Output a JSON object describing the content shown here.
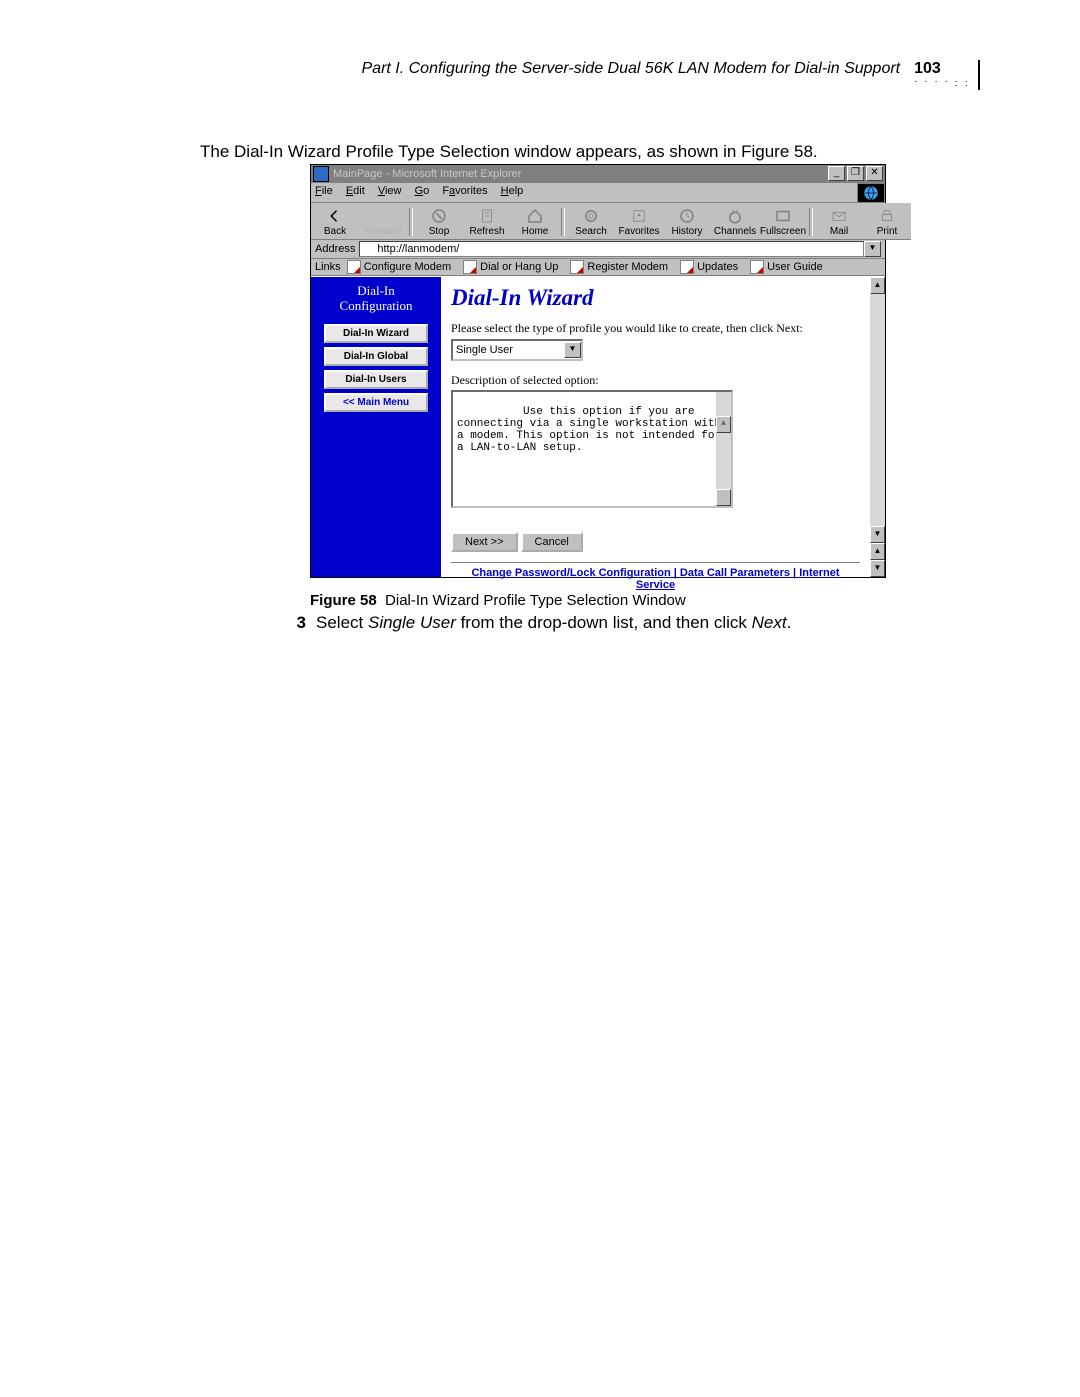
{
  "header": {
    "title": "Part I. Configuring the Server-side Dual 56K LAN Modem for Dial-in Support",
    "page_number": "103"
  },
  "intro_text": "The Dial-In Wizard Profile Type Selection window appears, as shown in Figure 58.",
  "figure": {
    "label": "Figure 58",
    "caption": "Dial-In Wizard Profile Type Selection Window"
  },
  "step": {
    "number": "3",
    "text_pre": "Select ",
    "italic1": "Single User",
    "text_mid": " from the drop-down list, and then click ",
    "italic2": "Next",
    "text_post": "."
  },
  "ie": {
    "title": "MainPage - Microsoft Internet Explorer",
    "menus": {
      "file": "File",
      "edit": "Edit",
      "view": "View",
      "go": "Go",
      "favorites": "Favorites",
      "help": "Help"
    },
    "toolbar": {
      "back": "Back",
      "forward": "Forward",
      "stop": "Stop",
      "refresh": "Refresh",
      "home": "Home",
      "search": "Search",
      "favorites": "Favorites",
      "history": "History",
      "channels": "Channels",
      "fullscreen": "Fullscreen",
      "mail": "Mail",
      "print": "Print"
    },
    "address_label": "Address",
    "address_value": "http://lanmodem/",
    "links_label": "Links",
    "links": {
      "l1": "Configure Modem",
      "l2": "Dial or Hang Up",
      "l3": "Register Modem",
      "l4": "Updates",
      "l5": "User Guide"
    }
  },
  "sidebar": {
    "title_line1": "Dial-In",
    "title_line2": "Configuration",
    "buttons": {
      "wizard": "Dial-In Wizard",
      "global": "Dial-In Global",
      "users": "Dial-In Users",
      "main": "<< Main Menu"
    }
  },
  "main": {
    "heading": "Dial-In Wizard",
    "prompt": "Please select the type of profile you would like to create, then click Next:",
    "select_value": "Single User",
    "desc_label": "Description of selected option:",
    "desc_text": "Use this option if you are connecting via a single workstation with a modem. This option is not intended for a LAN-to-LAN setup.",
    "next_btn": "Next >>",
    "cancel_btn": "Cancel",
    "footer": {
      "f1": "Change Password/Lock Configuration",
      "sep": " | ",
      "f2": "Data Call Parameters",
      "f3": "Internet Service"
    }
  }
}
